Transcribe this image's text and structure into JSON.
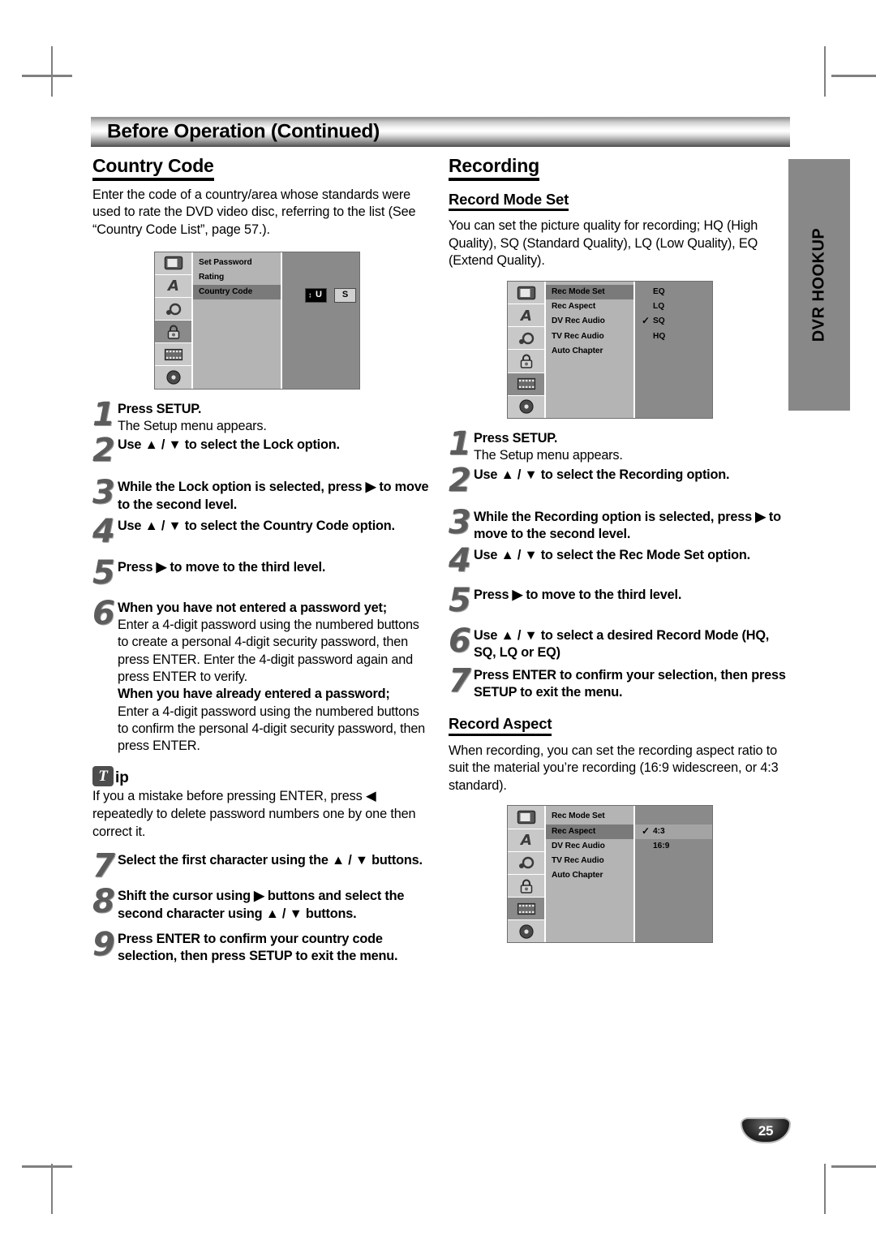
{
  "header": {
    "title": "Before Operation (Continued)"
  },
  "side_tab": {
    "label": "DVR HOOKUP"
  },
  "page_number": "25",
  "left": {
    "section_title": "Country Code",
    "intro": "Enter the code of a country/area whose standards were used to rate the DVD video disc, referring to the list (See “Country Code List”, page 57.).",
    "osd": {
      "icons": [
        "display-icon",
        "language-icon",
        "audio-icon",
        "lock-icon",
        "recording-icon",
        "disc-icon"
      ],
      "selected_icon_index": 3,
      "menu_items": [
        "Set Password",
        "Rating",
        "Country Code"
      ],
      "selected_menu_item": "Country Code",
      "code_chars": [
        "U",
        "S"
      ],
      "active_char_index": 0
    },
    "steps": [
      {
        "num": "1",
        "bold": "Press SETUP.",
        "plain": "The Setup menu appears."
      },
      {
        "num": "2",
        "bold": "Use ▲ / ▼ to select the Lock option.",
        "plain": ""
      },
      {
        "num": "3",
        "bold": "While the Lock option is selected, press ▶ to move to the second level.",
        "plain": ""
      },
      {
        "num": "4",
        "bold": "Use ▲ / ▼ to select the Country Code option.",
        "plain": ""
      },
      {
        "num": "5",
        "bold": "Press ▶ to move to the third level.",
        "plain": ""
      },
      {
        "num": "6",
        "bold": "When you have not entered a password yet;",
        "plain": "Enter a 4-digit password using the numbered buttons to create a personal 4-digit security password, then press ENTER. Enter the 4-digit password again and press ENTER to verify.",
        "bold2": "When you have already entered a password;",
        "plain2": "Enter a 4-digit password using the numbered buttons to confirm the personal 4-digit security password, then press ENTER."
      }
    ],
    "tip": {
      "badge_letter": "T",
      "word": "ip",
      "text": "If you a mistake before pressing ENTER, press ◀ repeatedly to delete password numbers one by one then correct it."
    },
    "steps2": [
      {
        "num": "7",
        "bold": "Select the first character using the ▲ / ▼ buttons.",
        "plain": ""
      },
      {
        "num": "8",
        "bold": "Shift the cursor using ▶ buttons and select the second character using ▲ / ▼ buttons.",
        "plain": ""
      },
      {
        "num": "9",
        "bold": "Press ENTER to confirm your country code selection, then press SETUP to exit the menu.",
        "plain": ""
      }
    ]
  },
  "right": {
    "section_title": "Recording",
    "sub_title_1": "Record Mode Set",
    "intro_1": "You can set the picture quality for recording; HQ (High Quality), SQ (Standard Quality), LQ (Low Quality), EQ (Extend Quality).",
    "osd1": {
      "icons": [
        "display-icon",
        "language-icon",
        "audio-icon",
        "lock-icon",
        "recording-icon",
        "disc-icon"
      ],
      "selected_icon_index": 4,
      "menu_items": [
        "Rec Mode Set",
        "Rec Aspect",
        "DV Rec Audio",
        "TV Rec Audio",
        "Auto Chapter"
      ],
      "selected_menu_item": "Rec Mode Set",
      "values": [
        "EQ",
        "LQ",
        "SQ",
        "HQ"
      ],
      "checked_value": "SQ",
      "selected_value": ""
    },
    "steps": [
      {
        "num": "1",
        "bold": "Press SETUP.",
        "plain": "The Setup menu appears."
      },
      {
        "num": "2",
        "bold": "Use ▲ / ▼ to select the Recording option.",
        "plain": ""
      },
      {
        "num": "3",
        "bold": "While the Recording option is selected, press ▶ to move to the second level.",
        "plain": ""
      },
      {
        "num": "4",
        "bold": "Use ▲ / ▼ to select the Rec Mode Set option.",
        "plain": ""
      },
      {
        "num": "5",
        "bold": "Press ▶ to move to the third level.",
        "plain": ""
      },
      {
        "num": "6",
        "bold": "Use ▲ / ▼ to select a desired Record Mode (HQ, SQ, LQ or EQ)",
        "plain": ""
      },
      {
        "num": "7",
        "bold": "Press ENTER to confirm your selection, then press SETUP to exit the menu.",
        "plain": ""
      }
    ],
    "sub_title_2": "Record Aspect",
    "intro_2": "When recording, you can set the recording aspect ratio to suit the material you’re recording (16:9 widescreen, or 4:3 standard).",
    "osd2": {
      "icons": [
        "display-icon",
        "language-icon",
        "audio-icon",
        "lock-icon",
        "recording-icon",
        "disc-icon"
      ],
      "selected_icon_index": 4,
      "menu_items": [
        "Rec Mode Set",
        "Rec Aspect",
        "DV Rec Audio",
        "TV Rec Audio",
        "Auto Chapter"
      ],
      "selected_menu_item": "Rec Aspect",
      "values": [
        "4:3",
        "16:9"
      ],
      "checked_value": "4:3",
      "selected_value": "4:3"
    }
  }
}
